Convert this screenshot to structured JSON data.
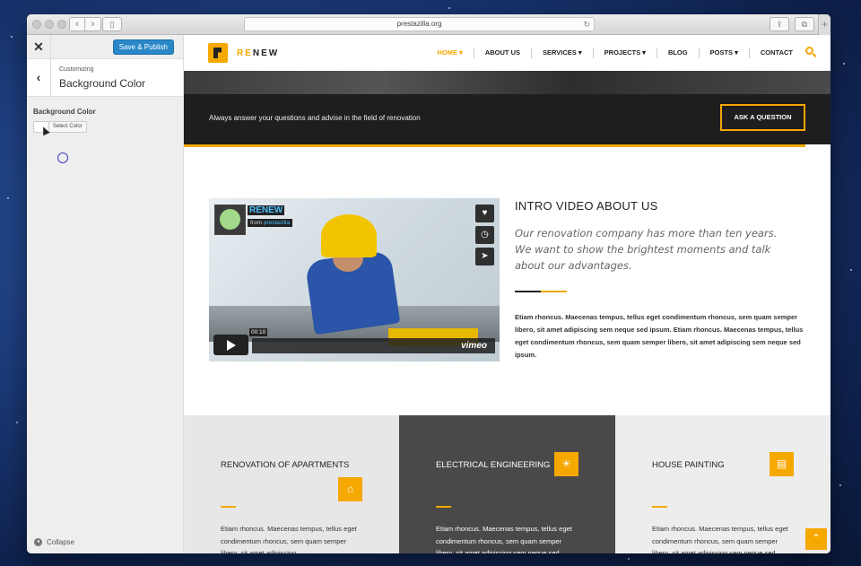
{
  "browser": {
    "url": "prestazilla.org",
    "back_glyph": "‹",
    "forward_glyph": "›",
    "sidebar_glyph": "▯",
    "reload_glyph": "↻",
    "share_glyph": "⇪",
    "tabs_glyph": "⧉",
    "new_tab_glyph": "+"
  },
  "customizer": {
    "close_glyph": "✕",
    "publish_label": "Save & Publish",
    "back_glyph": "‹",
    "breadcrumb": "Customizing",
    "title": "Background Color",
    "field_label": "Background Color",
    "select_color_label": "Select Color",
    "collapse_glyph": "◂",
    "collapse_label": "Collapse"
  },
  "site": {
    "logo_text_accent": "RE",
    "logo_text_rest": "NEW",
    "nav": [
      {
        "label": "HOME ▾"
      },
      {
        "label": "ABOUT US"
      },
      {
        "label": "SERVICES ▾"
      },
      {
        "label": "PROJECTS ▾"
      },
      {
        "label": "BLOG"
      },
      {
        "label": "POSTS ▾"
      },
      {
        "label": "CONTACT"
      }
    ],
    "cta_text": "Always answer your questions and advise in the field of renovation",
    "cta_button": "ASK A QUESTION",
    "video": {
      "channel_title": "RENEW",
      "from_label": "from",
      "from_user": "prestazilla",
      "time": "00:10",
      "brand": "vimeo",
      "like_glyph": "♥",
      "later_glyph": "◷",
      "share_glyph": "➤"
    },
    "intro": {
      "title": "INTRO VIDEO ABOUT US",
      "lead": "Our renovation company has more than ten years. We want to show the brightest moments and talk about our advantages.",
      "body": "Etiam rhoncus. Maecenas tempus, tellus eget condimentum rhoncus, sem quam semper libero, sit amet adipiscing sem neque sed ipsum. Etiam rhoncus. Maecenas tempus, tellus eget condimentum rhoncus, sem quam semper libero, sit amet adipiscing sem neque sed ipsum."
    },
    "services": [
      {
        "title": "RENOVATION OF APARTMENTS",
        "icon": "⌂",
        "text": "Etiam rhoncus. Maecenas tempus, tellus eget condimentum rhoncus, sem quam semper libero, sit amet adipiscing"
      },
      {
        "title": "ELECTRICAL ENGINEERING",
        "icon": "☀",
        "text": "Etiam rhoncus. Maecenas tempus, tellus eget condimentum rhoncus, sem quam semper libero, sit amet adipiscing sem neque sed ipsum. Nam quam nunc, blandit"
      },
      {
        "title": "HOUSE PAINTING",
        "icon": "▤",
        "text": "Etiam rhoncus. Maecenas tempus, tellus eget condimentum rhoncus, sem quam semper libero, sit amet adipiscing sem neque sed ipsum. Nam quam nunc, blandit"
      }
    ],
    "scroll_top_glyph": "⌃"
  },
  "colors": {
    "accent": "#f5a800",
    "publish": "#2a88c8",
    "dark_bar": "#1f1d1d",
    "service_1_bg": "#e7e7e7",
    "service_2_bg": "#4a4849",
    "service_3_bg": "#ededed"
  }
}
